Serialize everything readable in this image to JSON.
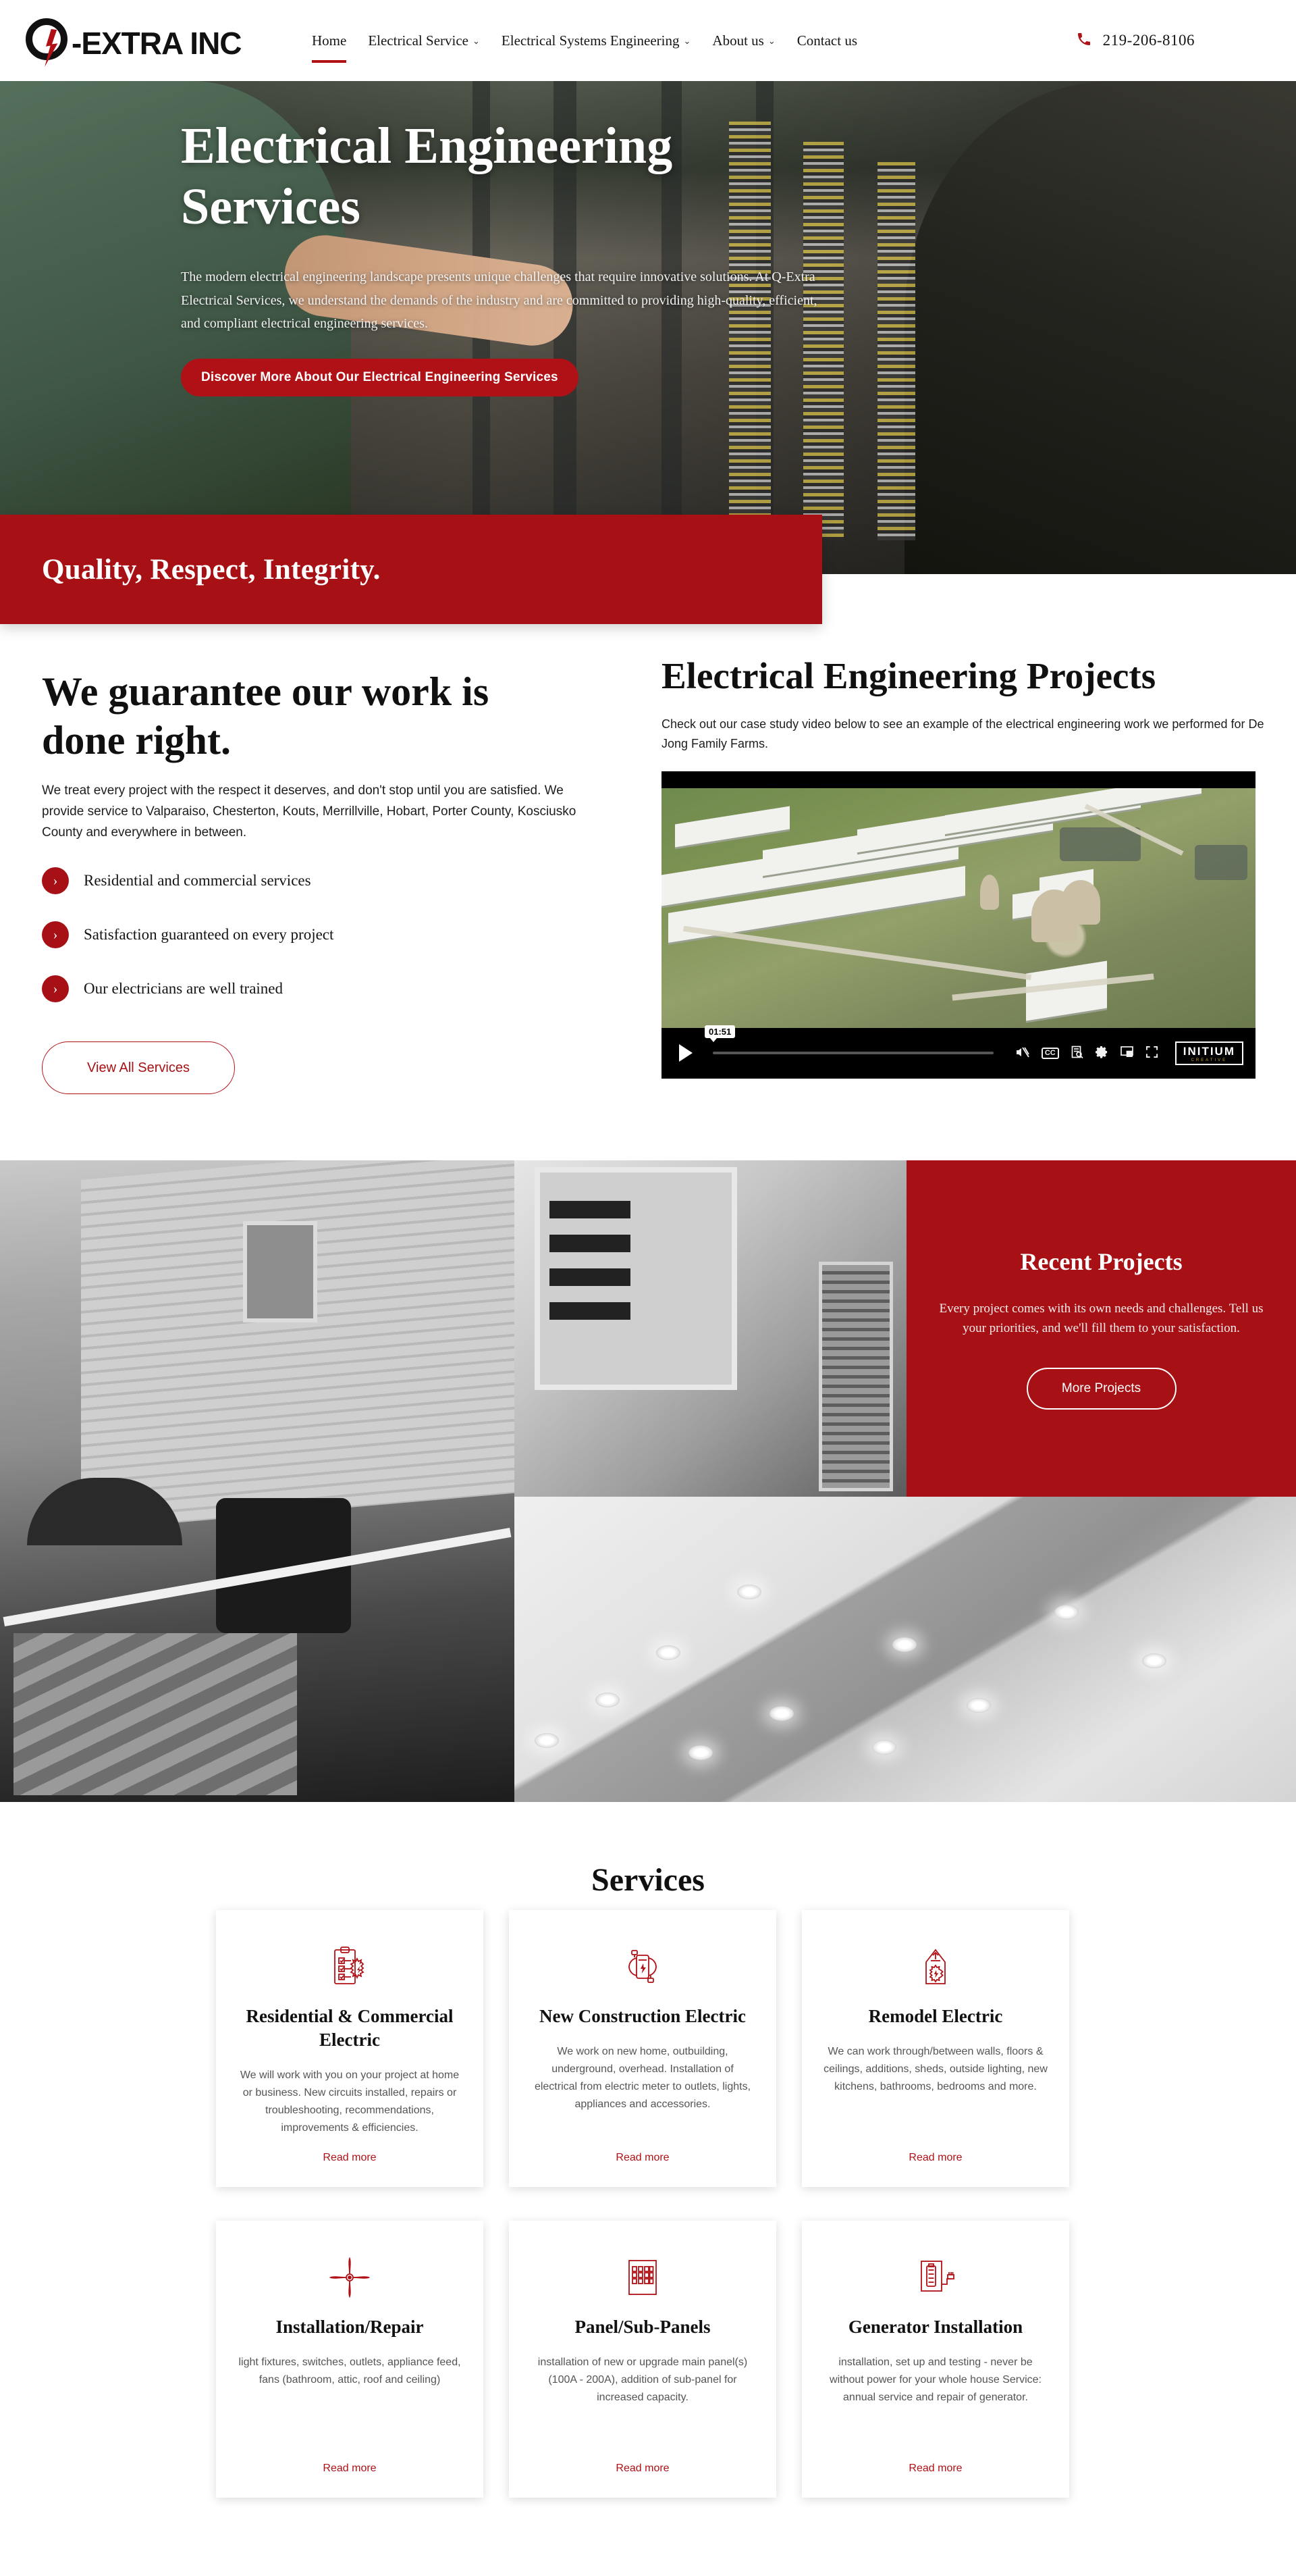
{
  "header": {
    "logo_text": "-EXTRA INC",
    "logo_mark": "Q",
    "nav": [
      {
        "label": "Home",
        "has_caret": false,
        "active": true
      },
      {
        "label": "Electrical Service",
        "has_caret": true,
        "active": false
      },
      {
        "label": "Electrical Systems Engineering",
        "has_caret": true,
        "active": false
      },
      {
        "label": "About us",
        "has_caret": true,
        "active": false
      },
      {
        "label": "Contact us",
        "has_caret": false,
        "active": false
      }
    ],
    "caret": "⌄",
    "phone_icon": "📞",
    "phone": "219-206-8106"
  },
  "hero": {
    "title": "Electrical Engineering Services",
    "subtitle": "The modern electrical engineering landscape presents unique challenges that require innovative solutions. At Q-Extra Electrical Services, we understand the demands of the industry and are committed to providing high-quality, efficient, and compliant electrical engineering services.",
    "cta_label": "Discover More About Our Electrical Engineering Services"
  },
  "quote_banner": {
    "text": "Quality, Respect, Integrity."
  },
  "guarantee": {
    "title": "We guarantee our work is done right.",
    "body": "We treat every project with the respect it deserves, and don't stop until you are satisfied. We provide service to Valparaiso, Chesterton, Kouts, Merrillville, Hobart, Porter County, Kosciusko County and everywhere in between.",
    "features": [
      {
        "bullet": "›",
        "label": "Residential and commercial services"
      },
      {
        "bullet": "›",
        "label": "Satisfaction guaranteed on every project"
      },
      {
        "bullet": "›",
        "label": "Our electricians are well trained"
      }
    ],
    "button_label": "View All Services"
  },
  "projects": {
    "title": "Electrical Engineering Projects",
    "subtitle": "Check out our case study video below to see an example of the electrical engineering work we performed for De Jong Family Farms.",
    "video": {
      "time": "01:51",
      "play_icon": "play-icon",
      "controls": [
        "mute-icon",
        "cc-icon",
        "transcript-icon",
        "settings-gear-icon",
        "picture-in-picture-icon",
        "fullscreen-icon"
      ],
      "cc_label": "CC",
      "brand_main": "INITIUM",
      "brand_sub": "CREATIVE"
    }
  },
  "recent_projects": {
    "title": "Recent Projects",
    "body": "Every project comes with its own needs and challenges. Tell us your priorities, and we'll fill them to your satisfaction.",
    "button_label": "More Projects"
  },
  "services": {
    "title": "Services",
    "read_more_label": "Read more",
    "cards": [
      {
        "icon": "clipboard-checklist-bolt-icon",
        "title": "Residential & Commercial Electric",
        "desc": "We will work with you on your project at home or business. New circuits installed, repairs or troubleshooting, recommendations, improvements & efficiencies."
      },
      {
        "icon": "wired-bolt-meter-icon",
        "title": "New Construction Electric",
        "desc": "We work on new home, outbuilding, underground, overhead. Installation of electrical from electric meter to outlets, lights, appliances and accessories."
      },
      {
        "icon": "house-gear-bolt-icon",
        "title": "Remodel Electric",
        "desc": "We can work through/between walls, floors & ceilings, additions, sheds, outside lighting, new kitchens, bathrooms, bedrooms and more."
      },
      {
        "icon": "ceiling-fan-icon",
        "title": "Installation/Repair",
        "desc": "light fixtures, switches, outlets, appliance feed, fans (bathroom, attic, roof and ceiling)"
      },
      {
        "icon": "breaker-panel-icon",
        "title": "Panel/Sub-Panels",
        "desc": "installation of new or upgrade main panel(s) (100A - 200A), addition of sub-panel for increased capacity."
      },
      {
        "icon": "generator-battery-crank-icon",
        "title": "Generator Installation",
        "desc": "installation, set up and testing - never be without power for your whole house Service: annual service and repair of generator."
      }
    ]
  },
  "colors": {
    "brand_red": "#a71115",
    "accent_red": "#b01116",
    "text_dark": "#111111",
    "text_muted": "#555555"
  }
}
